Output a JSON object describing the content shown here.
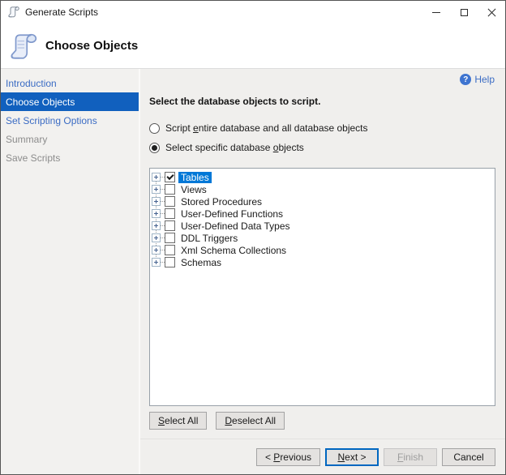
{
  "window": {
    "title": "Generate Scripts"
  },
  "header": {
    "title": "Choose Objects"
  },
  "sidebar": {
    "items": [
      {
        "name": "sidebar-item-introduction",
        "label": "Introduction",
        "state": "link"
      },
      {
        "name": "sidebar-item-choose-objects",
        "label": "Choose Objects",
        "state": "selected"
      },
      {
        "name": "sidebar-item-set-scripting-options",
        "label": "Set Scripting Options",
        "state": "link"
      },
      {
        "name": "sidebar-item-summary",
        "label": "Summary",
        "state": "disabled"
      },
      {
        "name": "sidebar-item-save-scripts",
        "label": "Save Scripts",
        "state": "disabled"
      }
    ]
  },
  "main": {
    "help_label": "Help",
    "help_icon_glyph": "?",
    "instruction": "Select the database objects to script.",
    "radios": [
      {
        "name": "radio-script-entire-database",
        "pre": "Script ",
        "accel": "e",
        "post": "ntire database and all database objects",
        "selected": false
      },
      {
        "name": "radio-select-specific-objects",
        "pre": "Select specific database ",
        "accel": "o",
        "post": "bjects",
        "selected": true
      }
    ],
    "tree": {
      "items": [
        {
          "label": "Tables",
          "checked": true,
          "selected": true
        },
        {
          "label": "Views",
          "checked": false,
          "selected": false
        },
        {
          "label": "Stored Procedures",
          "checked": false,
          "selected": false
        },
        {
          "label": "User-Defined Functions",
          "checked": false,
          "selected": false
        },
        {
          "label": "User-Defined Data Types",
          "checked": false,
          "selected": false
        },
        {
          "label": "DDL Triggers",
          "checked": false,
          "selected": false
        },
        {
          "label": "Xml Schema Collections",
          "checked": false,
          "selected": false
        },
        {
          "label": "Schemas",
          "checked": false,
          "selected": false
        }
      ]
    },
    "select_all": {
      "pre": "",
      "accel": "S",
      "post": "elect All"
    },
    "deselect_all": {
      "pre": "",
      "accel": "D",
      "post": "eselect All"
    }
  },
  "footer": {
    "buttons": [
      {
        "name": "previous-button",
        "pre": "< ",
        "accel": "P",
        "post": "revious",
        "style": "normal"
      },
      {
        "name": "next-button",
        "pre": "",
        "accel": "N",
        "post": "ext >",
        "style": "default"
      },
      {
        "name": "finish-button",
        "pre": "",
        "accel": "F",
        "post": "inish",
        "style": "disabled"
      },
      {
        "name": "cancel-button",
        "pre": "",
        "accel": "",
        "post": "Cancel",
        "style": "normal"
      }
    ]
  },
  "colors": {
    "sidebar_selected": "#1160BE",
    "tree_selection": "#0078D7",
    "link_blue": "#3B6CC4",
    "disabled_text": "#8C8C8C",
    "default_button_border": "#0067C0"
  }
}
